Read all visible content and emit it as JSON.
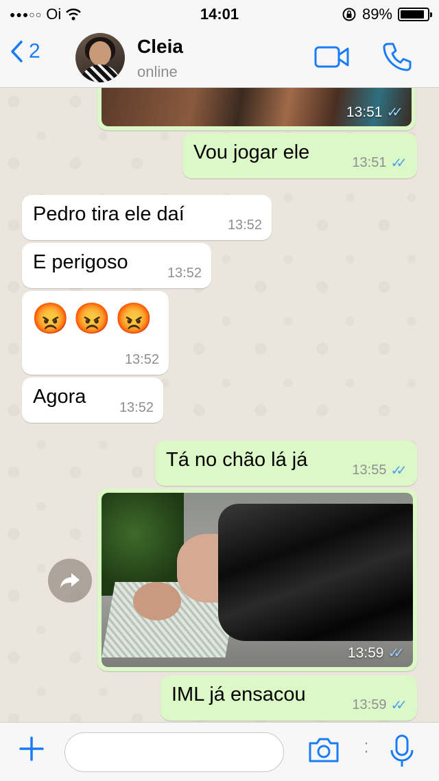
{
  "status_bar": {
    "carrier": "Oi",
    "time": "14:01",
    "battery": "89%",
    "battery_level": 0.89
  },
  "header": {
    "back_count": "2",
    "contact_name": "Cleia",
    "contact_status": "online",
    "icons": [
      "chevron-left-icon",
      "video-camera-icon",
      "phone-icon"
    ]
  },
  "messages": [
    {
      "type": "image",
      "direction": "out",
      "time": "13:51"
    },
    {
      "type": "text",
      "direction": "out",
      "text": "Vou jogar ele",
      "time": "13:51"
    },
    {
      "type": "text",
      "direction": "in",
      "text": "Pedro tira ele daí",
      "time": "13:52"
    },
    {
      "type": "text",
      "direction": "in",
      "text": "E perigoso",
      "time": "13:52"
    },
    {
      "type": "emoji",
      "direction": "in",
      "text": "😡😡😡",
      "time": "13:52"
    },
    {
      "type": "text",
      "direction": "in",
      "text": "Agora",
      "time": "13:52"
    },
    {
      "type": "text",
      "direction": "out",
      "text": "Tá no chão lá já",
      "time": "13:55"
    },
    {
      "type": "image",
      "direction": "out",
      "time": "13:59"
    },
    {
      "type": "text",
      "direction": "out",
      "text": "IML já ensacou",
      "time": "13:59"
    }
  ],
  "input_bar": {
    "placeholder": "",
    "icons": [
      "plus-icon",
      "camera-icon",
      "microphone-icon"
    ]
  },
  "colors": {
    "accent": "#1a7cf5",
    "outgoing_bubble": "#dcf8c6",
    "incoming_bubble": "#ffffff",
    "chat_background": "#ece5dd",
    "read_ticks": "#4aa3f0"
  }
}
